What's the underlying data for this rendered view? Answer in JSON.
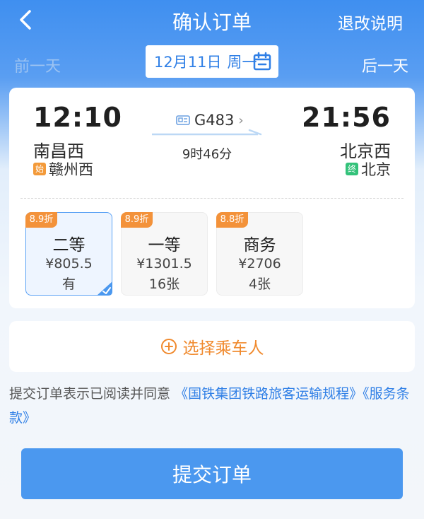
{
  "header": {
    "title": "确认订单",
    "refund_link": "退改说明"
  },
  "date_bar": {
    "prev_day": "前一天",
    "next_day": "后一天",
    "date": "12月11日",
    "weekday": "周一"
  },
  "train": {
    "departure_time": "12:10",
    "departure_station": "南昌西",
    "origin_tag": "始",
    "origin_station": "赣州西",
    "train_number": "G483",
    "duration": "9时46分",
    "arrival_time": "21:56",
    "arrival_station": "北京西",
    "terminal_tag": "终",
    "terminal_station": "北京"
  },
  "seats": [
    {
      "discount": "8.9折",
      "class": "二等",
      "price": "¥805.5",
      "availability": "有",
      "selected": true
    },
    {
      "discount": "8.9折",
      "class": "一等",
      "price": "¥1301.5",
      "availability": "16张",
      "selected": false
    },
    {
      "discount": "8.8折",
      "class": "商务",
      "price": "¥2706",
      "availability": "4张",
      "selected": false
    }
  ],
  "passenger": {
    "label": "选择乘车人"
  },
  "agreement": {
    "prefix": "提交订单表示已阅读并同意",
    "link1": "《国铁集团铁路旅客运输规程》",
    "link2": "《服务条款》"
  },
  "submit": {
    "label": "提交订单"
  },
  "colors": {
    "primary": "#4b98ef",
    "accent": "#f08a2e",
    "link": "#2f7fe6"
  }
}
